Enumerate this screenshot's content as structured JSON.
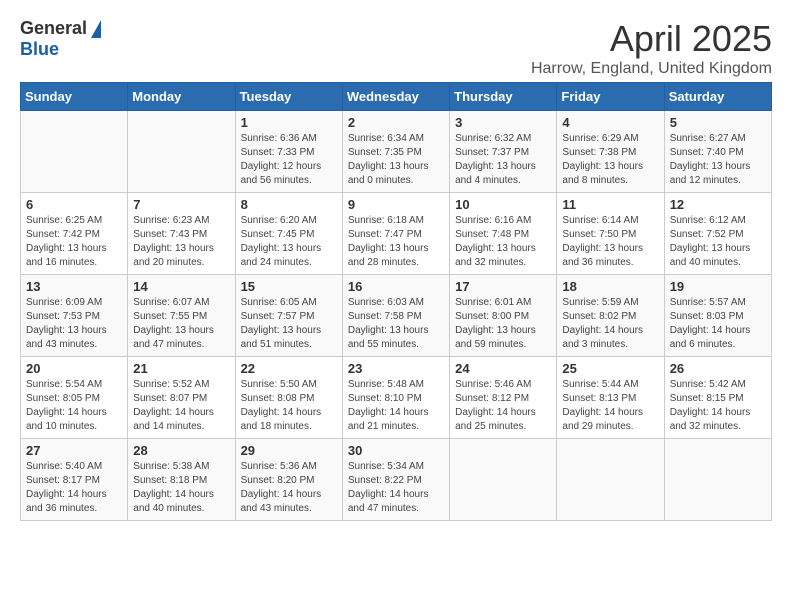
{
  "logo": {
    "general": "General",
    "blue": "Blue"
  },
  "title": "April 2025",
  "location": "Harrow, England, United Kingdom",
  "days_of_week": [
    "Sunday",
    "Monday",
    "Tuesday",
    "Wednesday",
    "Thursday",
    "Friday",
    "Saturday"
  ],
  "weeks": [
    [
      {
        "day": "",
        "info": ""
      },
      {
        "day": "",
        "info": ""
      },
      {
        "day": "1",
        "info": "Sunrise: 6:36 AM\nSunset: 7:33 PM\nDaylight: 12 hours and 56 minutes."
      },
      {
        "day": "2",
        "info": "Sunrise: 6:34 AM\nSunset: 7:35 PM\nDaylight: 13 hours and 0 minutes."
      },
      {
        "day": "3",
        "info": "Sunrise: 6:32 AM\nSunset: 7:37 PM\nDaylight: 13 hours and 4 minutes."
      },
      {
        "day": "4",
        "info": "Sunrise: 6:29 AM\nSunset: 7:38 PM\nDaylight: 13 hours and 8 minutes."
      },
      {
        "day": "5",
        "info": "Sunrise: 6:27 AM\nSunset: 7:40 PM\nDaylight: 13 hours and 12 minutes."
      }
    ],
    [
      {
        "day": "6",
        "info": "Sunrise: 6:25 AM\nSunset: 7:42 PM\nDaylight: 13 hours and 16 minutes."
      },
      {
        "day": "7",
        "info": "Sunrise: 6:23 AM\nSunset: 7:43 PM\nDaylight: 13 hours and 20 minutes."
      },
      {
        "day": "8",
        "info": "Sunrise: 6:20 AM\nSunset: 7:45 PM\nDaylight: 13 hours and 24 minutes."
      },
      {
        "day": "9",
        "info": "Sunrise: 6:18 AM\nSunset: 7:47 PM\nDaylight: 13 hours and 28 minutes."
      },
      {
        "day": "10",
        "info": "Sunrise: 6:16 AM\nSunset: 7:48 PM\nDaylight: 13 hours and 32 minutes."
      },
      {
        "day": "11",
        "info": "Sunrise: 6:14 AM\nSunset: 7:50 PM\nDaylight: 13 hours and 36 minutes."
      },
      {
        "day": "12",
        "info": "Sunrise: 6:12 AM\nSunset: 7:52 PM\nDaylight: 13 hours and 40 minutes."
      }
    ],
    [
      {
        "day": "13",
        "info": "Sunrise: 6:09 AM\nSunset: 7:53 PM\nDaylight: 13 hours and 43 minutes."
      },
      {
        "day": "14",
        "info": "Sunrise: 6:07 AM\nSunset: 7:55 PM\nDaylight: 13 hours and 47 minutes."
      },
      {
        "day": "15",
        "info": "Sunrise: 6:05 AM\nSunset: 7:57 PM\nDaylight: 13 hours and 51 minutes."
      },
      {
        "day": "16",
        "info": "Sunrise: 6:03 AM\nSunset: 7:58 PM\nDaylight: 13 hours and 55 minutes."
      },
      {
        "day": "17",
        "info": "Sunrise: 6:01 AM\nSunset: 8:00 PM\nDaylight: 13 hours and 59 minutes."
      },
      {
        "day": "18",
        "info": "Sunrise: 5:59 AM\nSunset: 8:02 PM\nDaylight: 14 hours and 3 minutes."
      },
      {
        "day": "19",
        "info": "Sunrise: 5:57 AM\nSunset: 8:03 PM\nDaylight: 14 hours and 6 minutes."
      }
    ],
    [
      {
        "day": "20",
        "info": "Sunrise: 5:54 AM\nSunset: 8:05 PM\nDaylight: 14 hours and 10 minutes."
      },
      {
        "day": "21",
        "info": "Sunrise: 5:52 AM\nSunset: 8:07 PM\nDaylight: 14 hours and 14 minutes."
      },
      {
        "day": "22",
        "info": "Sunrise: 5:50 AM\nSunset: 8:08 PM\nDaylight: 14 hours and 18 minutes."
      },
      {
        "day": "23",
        "info": "Sunrise: 5:48 AM\nSunset: 8:10 PM\nDaylight: 14 hours and 21 minutes."
      },
      {
        "day": "24",
        "info": "Sunrise: 5:46 AM\nSunset: 8:12 PM\nDaylight: 14 hours and 25 minutes."
      },
      {
        "day": "25",
        "info": "Sunrise: 5:44 AM\nSunset: 8:13 PM\nDaylight: 14 hours and 29 minutes."
      },
      {
        "day": "26",
        "info": "Sunrise: 5:42 AM\nSunset: 8:15 PM\nDaylight: 14 hours and 32 minutes."
      }
    ],
    [
      {
        "day": "27",
        "info": "Sunrise: 5:40 AM\nSunset: 8:17 PM\nDaylight: 14 hours and 36 minutes."
      },
      {
        "day": "28",
        "info": "Sunrise: 5:38 AM\nSunset: 8:18 PM\nDaylight: 14 hours and 40 minutes."
      },
      {
        "day": "29",
        "info": "Sunrise: 5:36 AM\nSunset: 8:20 PM\nDaylight: 14 hours and 43 minutes."
      },
      {
        "day": "30",
        "info": "Sunrise: 5:34 AM\nSunset: 8:22 PM\nDaylight: 14 hours and 47 minutes."
      },
      {
        "day": "",
        "info": ""
      },
      {
        "day": "",
        "info": ""
      },
      {
        "day": "",
        "info": ""
      }
    ]
  ]
}
